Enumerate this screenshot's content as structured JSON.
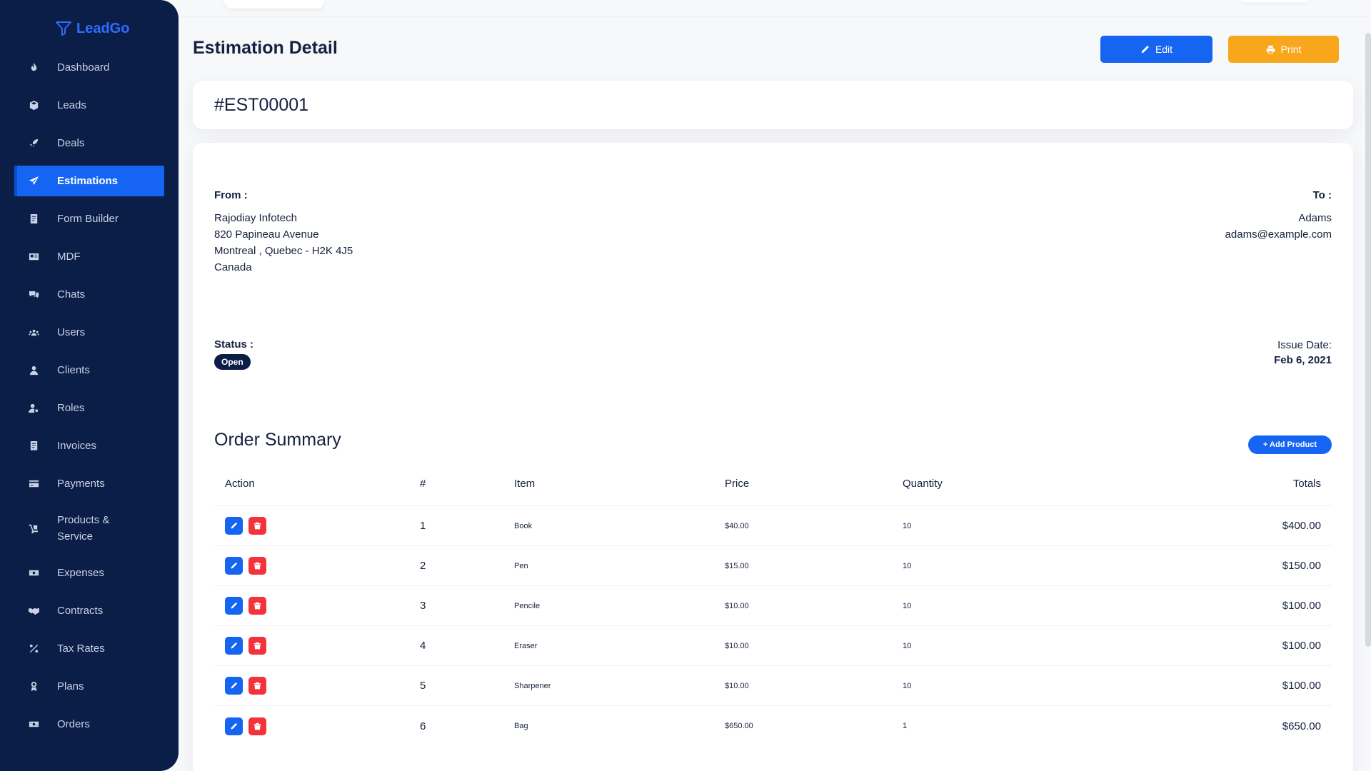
{
  "app": {
    "name": "LeadGo"
  },
  "sidebar": {
    "items": [
      {
        "label": "Dashboard",
        "icon": "flame-icon"
      },
      {
        "label": "Leads",
        "icon": "cube-icon"
      },
      {
        "label": "Deals",
        "icon": "rocket-icon"
      },
      {
        "label": "Estimations",
        "icon": "paper-plane-icon",
        "active": true
      },
      {
        "label": "Form Builder",
        "icon": "form-icon"
      },
      {
        "label": "MDF",
        "icon": "id-card-icon"
      },
      {
        "label": "Chats",
        "icon": "chat-icon"
      },
      {
        "label": "Users",
        "icon": "users-icon"
      },
      {
        "label": "Clients",
        "icon": "user-icon"
      },
      {
        "label": "Roles",
        "icon": "user-cog-icon"
      },
      {
        "label": "Invoices",
        "icon": "invoice-icon"
      },
      {
        "label": "Payments",
        "icon": "credit-card-icon"
      },
      {
        "label": "Products & Service",
        "icon": "dolly-icon"
      },
      {
        "label": "Expenses",
        "icon": "money-icon"
      },
      {
        "label": "Contracts",
        "icon": "handshake-icon"
      },
      {
        "label": "Tax Rates",
        "icon": "percent-icon"
      },
      {
        "label": "Plans",
        "icon": "award-icon"
      },
      {
        "label": "Orders",
        "icon": "money-bill-icon"
      }
    ]
  },
  "header": {
    "title": "Estimation Detail",
    "edit_label": "Edit",
    "print_label": "Print"
  },
  "estimation": {
    "number": "#EST00001",
    "from_label": "From :",
    "from_lines": [
      "Rajodiay Infotech",
      "820 Papineau Avenue",
      "Montreal , Quebec - H2K 4J5",
      "Canada"
    ],
    "to_label": "To :",
    "to_lines": [
      "Adams",
      "adams@example.com"
    ],
    "status_label": "Status :",
    "status": "Open",
    "issue_date_label": "Issue Date:",
    "issue_date": "Feb 6, 2021"
  },
  "order_summary": {
    "title": "Order Summary",
    "add_product_label": "+ Add Product",
    "columns": [
      "Action",
      "#",
      "Item",
      "Price",
      "Quantity",
      "Totals"
    ],
    "rows": [
      {
        "num": "1",
        "item": "Book",
        "price": "$40.00",
        "qty": "10",
        "total": "$400.00"
      },
      {
        "num": "2",
        "item": "Pen",
        "price": "$15.00",
        "qty": "10",
        "total": "$150.00"
      },
      {
        "num": "3",
        "item": "Pencile",
        "price": "$10.00",
        "qty": "10",
        "total": "$100.00"
      },
      {
        "num": "4",
        "item": "Eraser",
        "price": "$10.00",
        "qty": "10",
        "total": "$100.00"
      },
      {
        "num": "5",
        "item": "Sharpener",
        "price": "$10.00",
        "qty": "10",
        "total": "$100.00"
      },
      {
        "num": "6",
        "item": "Bag",
        "price": "$650.00",
        "qty": "1",
        "total": "$650.00"
      }
    ]
  },
  "colors": {
    "sidebar": "#0b1e47",
    "primary": "#1565f2",
    "warning": "#f8a71c",
    "danger": "#f4323c"
  }
}
